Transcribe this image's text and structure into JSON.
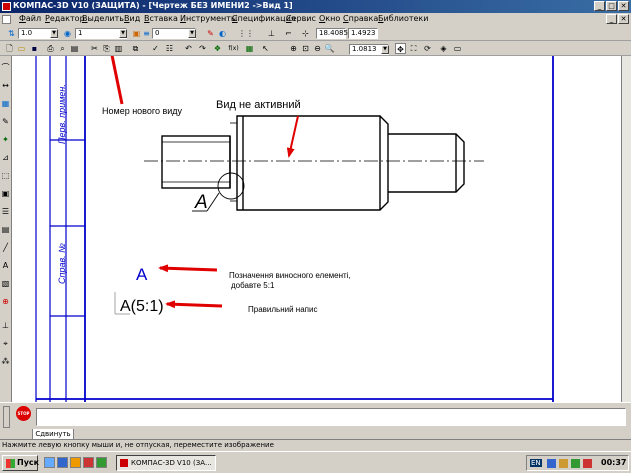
{
  "window": {
    "title": "КОМПАС-3D V10 (ЗАЩИТА) - [Чертеж БЕЗ ИМЕНИ2 ->Вид 1]",
    "minimize_glyph": "_",
    "maximize_glyph": "□",
    "close_glyph": "✕",
    "doc_minimize_glyph": "_",
    "doc_close_glyph": "✕"
  },
  "menu": [
    "Файл",
    "Редактор",
    "Выделить",
    "Вид",
    "Вставка",
    "Инструменты",
    "Спецификация",
    "Сервис",
    "Окно",
    "Справка",
    "Библиотеки"
  ],
  "toolbar1": {
    "scale_value": "1.0",
    "view_number_value": "1",
    "layer_value": "0",
    "coord_x": "18.4085",
    "coord_y": "1.4923"
  },
  "toolbar2": {
    "zoom_value": "1.0813"
  },
  "annotations": {
    "view_number_label": "Номер нового виду",
    "view_inactive_label": "Вид не активний",
    "callout_letter": "А",
    "blue_designation": "А",
    "designation_note_line1": "Позначення виносного елементі,",
    "designation_note_line2": "добавте 5:1",
    "correct_label": "А(5:1)",
    "correct_note": "Правильний напис"
  },
  "frame_side_labels": {
    "upper": "Перв. примен.",
    "lower": "Справ. №"
  },
  "props_panel": {
    "tab_label": "Сдвинуть",
    "stop_label": "STOP"
  },
  "status_text": "Нажмите левую кнопку мыши и, не отпуская, переместите изображение",
  "taskbar": {
    "start_label": "Пуск",
    "task_label": "КОМПАС-3D V10 (ЗА...",
    "lang": "EN",
    "clock": "00:37"
  },
  "colors": {
    "arrow_red": "#e00000",
    "frame_blue": "#0000cc",
    "titlebar": "#0a246a"
  }
}
